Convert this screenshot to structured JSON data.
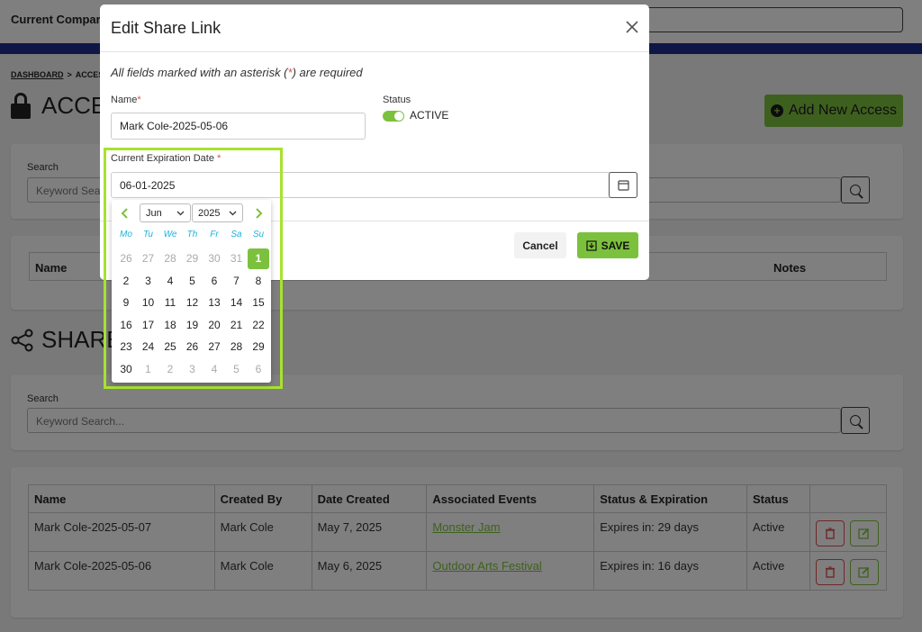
{
  "header": {
    "company_label": "Current Compar"
  },
  "breadcrumb": {
    "dashboard": "DASHBOARD",
    "separator": ">",
    "current": "ACCES"
  },
  "access_section": {
    "title": "ACCE",
    "add_button": "Add New Access",
    "search_label": "Search",
    "search_placeholder": "Keyword Sea"
  },
  "access_table": {
    "columns": [
      "Name",
      "Notes"
    ]
  },
  "share_section": {
    "title": "SHARE",
    "search_label": "Search",
    "search_placeholder": "Keyword Search..."
  },
  "share_table": {
    "columns": [
      "Name",
      "Created By",
      "Date Created",
      "Associated Events",
      "Status & Expiration",
      "Status",
      ""
    ],
    "rows": [
      {
        "name": "Mark Cole-2025-05-07",
        "created_by": "Mark Cole",
        "date_created": "May 7, 2025",
        "event": "Monster Jam",
        "expiration": "Expires in: 29 days",
        "status": "Active"
      },
      {
        "name": "Mark Cole-2025-05-06",
        "created_by": "Mark Cole",
        "date_created": "May 6, 2025",
        "event": "Outdoor Arts Festival",
        "expiration": "Expires in: 16 days",
        "status": "Active"
      }
    ]
  },
  "modal": {
    "title": "Edit Share Link",
    "required_note_pre": "All fields marked with an asterisk (",
    "required_note_star": "*",
    "required_note_post": ") are required",
    "name_label": "Name",
    "name_value": "Mark Cole-2025-05-06",
    "status_label": "Status",
    "status_value": "ACTIVE",
    "expiration_label": "Current Expiration Date",
    "expiration_value": "06-01-2025",
    "cancel_label": "Cancel",
    "save_label": "SAVE"
  },
  "datepicker": {
    "month": "Jun",
    "year": "2025",
    "weekdays": [
      "Mo",
      "Tu",
      "We",
      "Th",
      "Fr",
      "Sa",
      "Su"
    ],
    "weeks": [
      [
        "26",
        "27",
        "28",
        "29",
        "30",
        "31",
        "1"
      ],
      [
        "2",
        "3",
        "4",
        "5",
        "6",
        "7",
        "8"
      ],
      [
        "9",
        "10",
        "11",
        "12",
        "13",
        "14",
        "15"
      ],
      [
        "16",
        "17",
        "18",
        "19",
        "20",
        "21",
        "22"
      ],
      [
        "23",
        "24",
        "25",
        "26",
        "27",
        "28",
        "29"
      ],
      [
        "30",
        "1",
        "2",
        "3",
        "4",
        "5",
        "6"
      ]
    ],
    "selected": "1"
  },
  "colors": {
    "accent": "#7cc13e",
    "danger": "#d9534f",
    "weekday": "#1fb3d8",
    "highlight": "#a7e22e",
    "nav": "#1c2f8a"
  }
}
